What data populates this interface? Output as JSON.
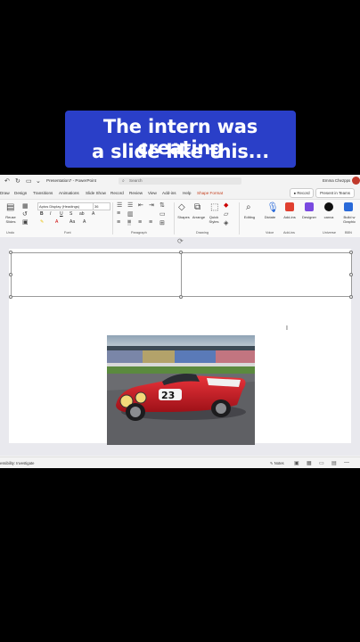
{
  "caption": {
    "line1": "The intern was creating",
    "line2": "a slide like this..."
  },
  "titlebar": {
    "document_name": "Presentation7 - PowerPoint",
    "search_placeholder": "Search",
    "user_name": "Emma Chezpps"
  },
  "menu": {
    "items": [
      "Draw",
      "Design",
      "Transitions",
      "Animations",
      "Slide Show",
      "Record",
      "Review",
      "View",
      "Add-ins",
      "Help",
      "Shape Format"
    ],
    "active": "Shape Format",
    "record_label": "Record",
    "present_label": "Present in Teams"
  },
  "ribbon": {
    "reuse_label": "Reuse Slides",
    "font_name": "Aptos Display (Headings)",
    "font_size": "36",
    "shapes_label": "Shapes",
    "arrange_label": "Arrange",
    "quick_styles_label": "Quick Styles",
    "editing_label": "Editing",
    "dictate_label": "Dictate",
    "addins_label": "Add-ins",
    "designer_label": "Designer",
    "canva_label": "canva",
    "buildwith_label": "Build w Graphic",
    "groups": [
      "Undo",
      "Font",
      "Paragraph",
      "Drawing",
      "Voice",
      "Add-ins",
      "Universe",
      "BBN"
    ]
  },
  "status": {
    "accessibility": "essibility: Investigate",
    "notes": "Notes"
  },
  "colors": {
    "accent": "#c43e1c",
    "caption_bg": "#2a3fc8"
  }
}
